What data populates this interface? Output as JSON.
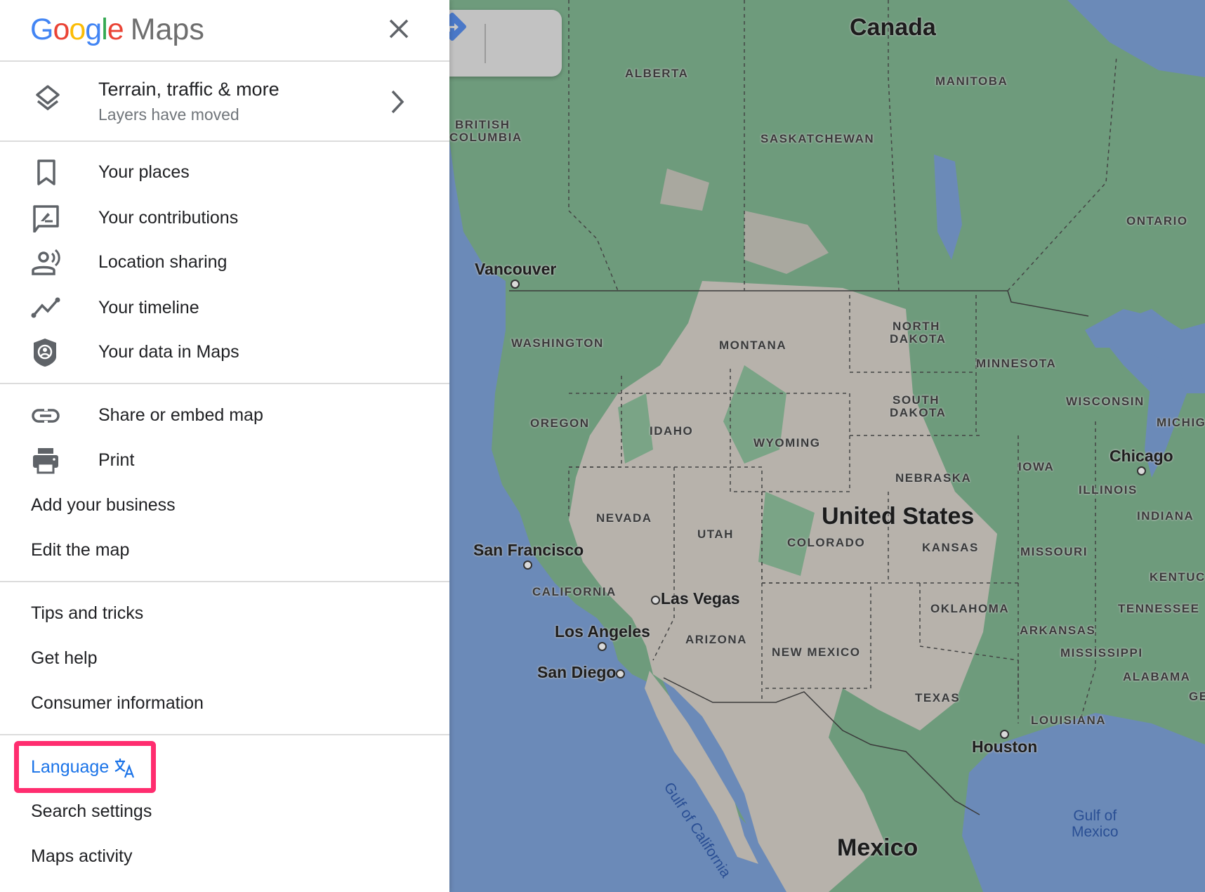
{
  "panel": {
    "logo": {
      "letters": [
        "G",
        "o",
        "o",
        "g",
        "l",
        "e"
      ],
      "suffix": "Maps"
    },
    "layers": {
      "title": "Terrain, traffic & more",
      "subtitle": "Layers have moved"
    },
    "groups": [
      [
        {
          "label": "Your places",
          "icon": "bookmark-icon"
        },
        {
          "label": "Your contributions",
          "icon": "contributions-icon"
        },
        {
          "label": "Location sharing",
          "icon": "location-sharing-icon"
        },
        {
          "label": "Your timeline",
          "icon": "timeline-icon"
        },
        {
          "label": "Your data in Maps",
          "icon": "shield-account-icon"
        }
      ],
      [
        {
          "label": "Share or embed map",
          "icon": "link-icon"
        },
        {
          "label": "Print",
          "icon": "printer-icon"
        },
        {
          "label": "Add your business"
        },
        {
          "label": "Edit the map"
        }
      ],
      [
        {
          "label": "Tips and tricks"
        },
        {
          "label": "Get help"
        },
        {
          "label": "Consumer information"
        }
      ],
      [
        {
          "label": "Language",
          "icon": "translate-icon",
          "highlighted": true,
          "color": "#1a73e8"
        },
        {
          "label": "Search settings"
        },
        {
          "label": "Maps activity"
        }
      ]
    ]
  },
  "highlight_color": "#ff2d6f",
  "map": {
    "countries": [
      "Canada",
      "United States",
      "Mexico"
    ],
    "regions": [
      "ALBERTA",
      "MANITOBA",
      "BRITISH",
      "COLUMBIA",
      "SASKATCHEWAN",
      "ONTARIO",
      "WASHINGTON",
      "MONTANA",
      "NORTH",
      "DAKOTA",
      "MINNESOTA",
      "SOUTH",
      "DAKOTA",
      "WISCONSIN",
      "MICHIG",
      "OREGON",
      "IDAHO",
      "WYOMING",
      "IOWA",
      "NEBRASKA",
      "ILLINOIS",
      "INDIANA",
      "NEVADA",
      "UTAH",
      "COLORADO",
      "KANSAS",
      "MISSOURI",
      "KENTUC",
      "CALIFORNIA",
      "OKLAHOMA",
      "TENNESSEE",
      "ARIZONA",
      "NEW MEXICO",
      "ARKANSAS",
      "MISSISSIPPI",
      "ALABAMA",
      "TEXAS",
      "GE",
      "LOUISIANA"
    ],
    "cities": [
      "Vancouver",
      "San Francisco",
      "Las Vegas",
      "Los Angeles",
      "San Diego",
      "Chicago",
      "Houston"
    ],
    "water": {
      "gulf_mexico": "Gulf of\nMexico",
      "gulf_california": "Gulf of California"
    },
    "colors": {
      "water": "#6b8ab8",
      "forest": "#6e9b7c",
      "land": "#b7b2ab"
    }
  }
}
